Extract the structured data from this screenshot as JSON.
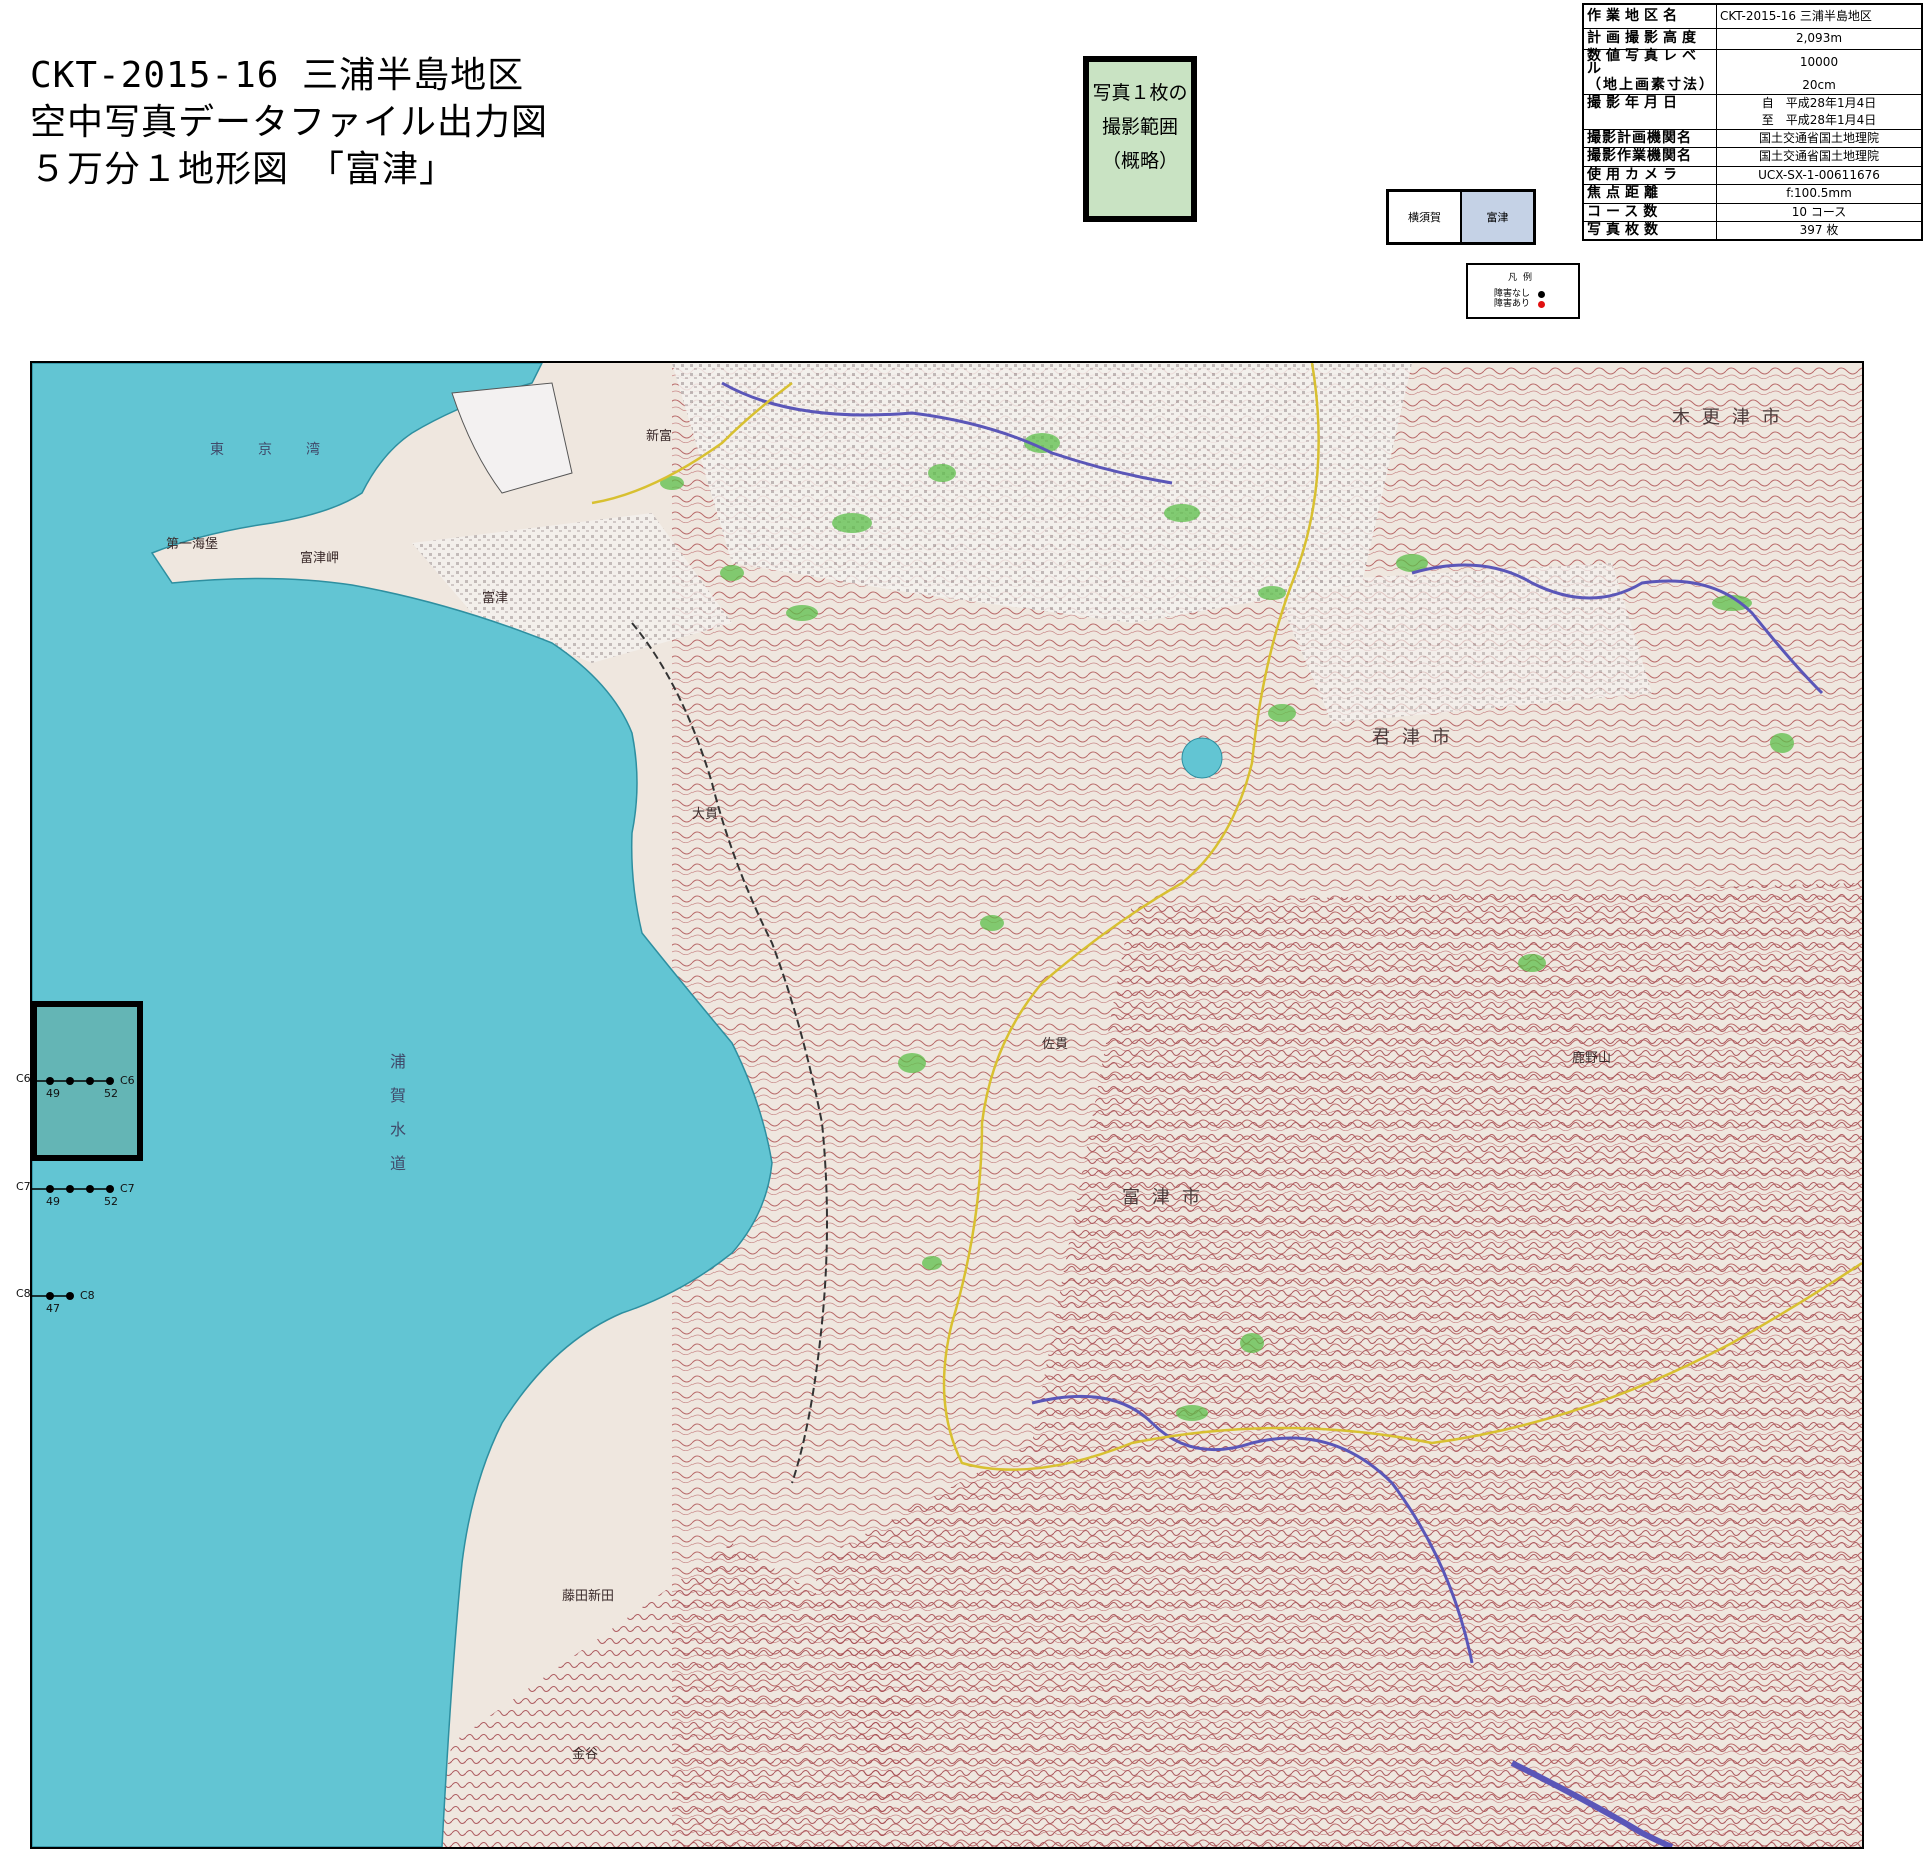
{
  "title": {
    "line1": "CKT-2015-16 三浦半島地区",
    "line2": "空中写真データファイル出力図",
    "line3": "５万分１地形図　「富津」"
  },
  "coverage_box": {
    "line1": "写真１枚の",
    "line2": "撮影範囲",
    "line3": "（概略）",
    "color": "#c9e3c3"
  },
  "sheet_index": {
    "left_label": "横須賀",
    "right_label": "富津",
    "selected_color": "#c5d2e6"
  },
  "legend": {
    "title": "凡例",
    "items": [
      {
        "label": "障害なし",
        "color": "#000000"
      },
      {
        "label": "障害あり",
        "color": "#e01010"
      }
    ]
  },
  "info_table": [
    {
      "key": "作業地区名",
      "value": "CKT-2015-16 三浦半島地区"
    },
    {
      "key": "計画撮影高度",
      "value": "2,093m"
    },
    {
      "key": "数値写真レベル",
      "value": "10000"
    },
    {
      "key": "（地上画素寸法）",
      "value": "20cm"
    },
    {
      "key": "撮影年月日",
      "value": "自　平成28年1月4日"
    },
    {
      "key": "",
      "value": "至　平成28年1月4日"
    },
    {
      "key": "撮影計画機関名",
      "value": "国土交通省国土地理院"
    },
    {
      "key": "撮影作業機関名",
      "value": "国土交通省国土地理院"
    },
    {
      "key": "使用カメラ",
      "value": "UCX-SX-1-00611676"
    },
    {
      "key": "焦点距離",
      "value": "f:100.5mm"
    },
    {
      "key": "コース数",
      "value": "10 コース"
    },
    {
      "key": "写真枚数",
      "value": "397 枚"
    }
  ],
  "map": {
    "sea_color": "#62c5d3",
    "land_color": "#efe7df",
    "relief_color": "#b96a6a",
    "vegetation_color": "#5cbf4a",
    "place_labels": {
      "tokyo_bay": "東京湾",
      "uraga_channel": "浦賀水道",
      "futtsu_city": "富津市",
      "kimitsu_city": "君津市",
      "kisarazu_city": "木更津市",
      "futtsu": "富津",
      "futtsu_cape": "富津岬",
      "daiichi_kaiho": "第一海堡",
      "shinfutsu": "新富",
      "onuki": "大貫",
      "sanuki": "佐貫",
      "kanaya": "金谷",
      "kanozan": "鹿野山",
      "shinden": "藤田新田"
    },
    "flight_lines": [
      {
        "course": "C6",
        "start": "49",
        "end": "52",
        "count": 4
      },
      {
        "course": "C7",
        "start": "49",
        "end": "52",
        "count": 4
      },
      {
        "course": "C8",
        "start": "47",
        "end": "",
        "count": 2
      }
    ]
  }
}
